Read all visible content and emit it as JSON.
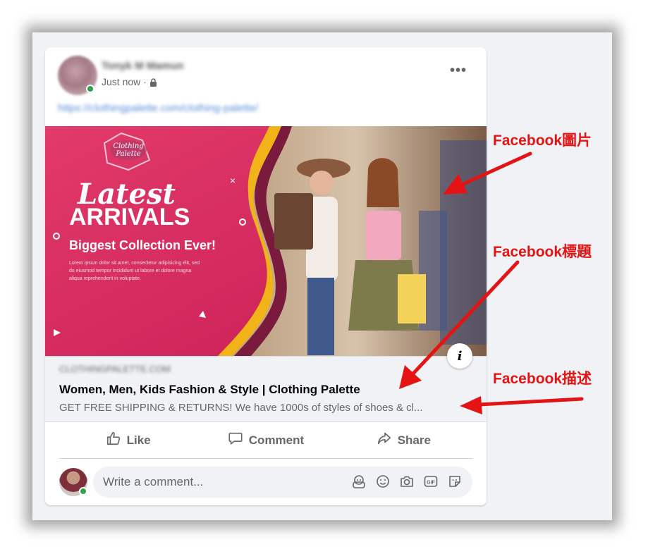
{
  "post": {
    "author_name": "Tonyk M Mamun",
    "timestamp": "Just now",
    "separator": "·",
    "link_url": "https://clothingpalette.com/clothing-palette/",
    "more_label": "•••"
  },
  "preview": {
    "badge_label": "i",
    "logo_line1": "Clothing",
    "logo_line2": "Palette",
    "headline_script": "Latest",
    "headline_caps": "ARRIVALS",
    "subheadline": "Biggest Collection Ever!",
    "lorem_1": "Lorem ipsum dolor sit amet, consectetur adipisicing elit, sed",
    "lorem_2": "do eiusmod tempor incididunt ut labore et dolore magna",
    "lorem_3": "aliqua reprehenderit in voluptate."
  },
  "link": {
    "domain": "CLOTHINGPALETTE.COM",
    "title": "Women, Men, Kids Fashion & Style | Clothing Palette",
    "description": "GET FREE SHIPPING & RETURNS! We have 1000s of styles of shoes & cl..."
  },
  "actions": {
    "like": "Like",
    "comment": "Comment",
    "share": "Share"
  },
  "comment": {
    "placeholder": "Write a comment..."
  },
  "annotations": {
    "image_label": "Facebook圖片",
    "title_label": "Facebook標題",
    "description_label": "Facebook描述"
  },
  "colors": {
    "accent_red": "#e41414",
    "online_green": "#31a24c",
    "banner_pink": "#d4285c"
  }
}
